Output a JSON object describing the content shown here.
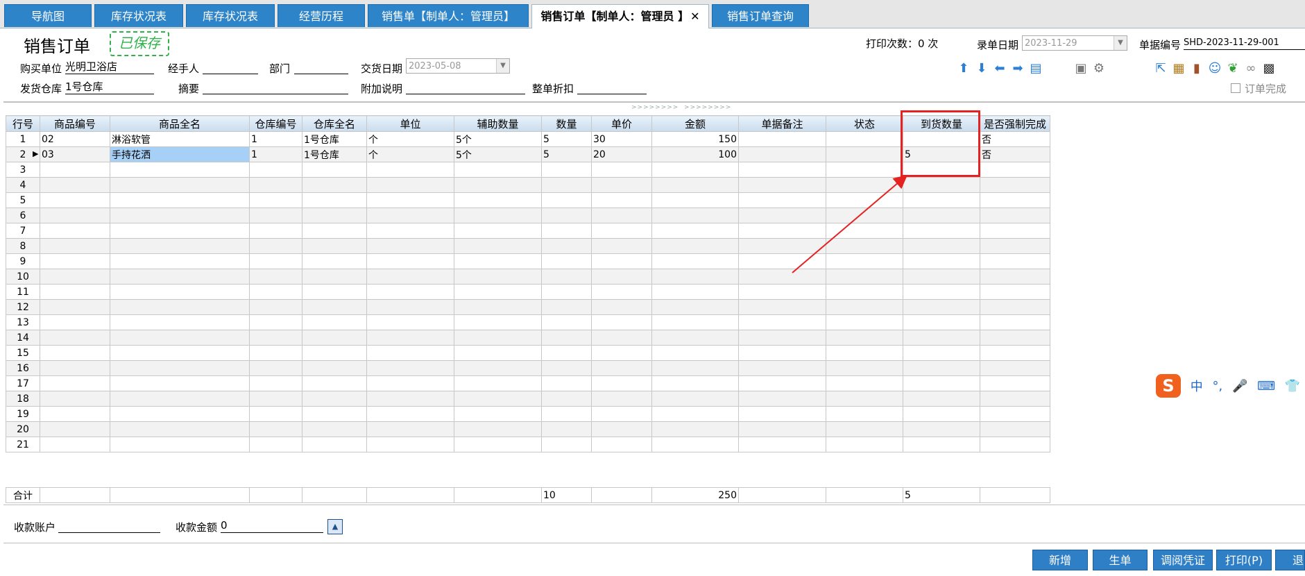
{
  "tabs": [
    {
      "label": "导航图"
    },
    {
      "label": "库存状况表"
    },
    {
      "label": "库存状况表"
    },
    {
      "label": "经营历程"
    },
    {
      "label": "销售单【制单人：管理员】"
    },
    {
      "label": "销售订单【制单人：管理员 】",
      "close": "✕"
    },
    {
      "label": "销售订单查询"
    }
  ],
  "header": {
    "title": "销售订单",
    "stamp": "已保存",
    "print_count_label": "打印次数：0 次",
    "entry_date_label": "录单日期",
    "entry_date_value": "2023-11-29",
    "doc_no_label": "单据编号",
    "doc_no_value": "SHD-2023-11-29-001",
    "buyer_label": "购买单位",
    "buyer_value": "光明卫浴店",
    "handler_label": "经手人",
    "handler_value": "",
    "dept_label": "部门",
    "dept_value": "",
    "delivery_date_label": "交货日期",
    "delivery_date_value": "2023-05-08",
    "warehouse_label": "发货仓库",
    "warehouse_value": "1号仓库",
    "summary_label": "摘要",
    "summary_value": "",
    "note_label": "附加说明",
    "note_value": "",
    "discount_label": "整单折扣",
    "discount_value": "",
    "order_complete_label": "订单完成"
  },
  "toolbar_icons": [
    "arrow-up-icon",
    "arrow-down-icon",
    "arrow-left-icon",
    "arrow-right-icon",
    "copy-doc-icon",
    "printer-icon",
    "gear-icon",
    "export-icon",
    "box-icon",
    "door-icon",
    "user-icon",
    "leaf-icon",
    "link-icon",
    "qrcode-icon"
  ],
  "grid": {
    "columns": [
      "行号",
      "商品编号",
      "商品全名",
      "仓库编号",
      "仓库全名",
      "单位",
      "辅助数量",
      "数量",
      "单价",
      "金额",
      "单据备注",
      "状态",
      "到货数量",
      "是否强制完成"
    ],
    "rows": [
      [
        "1",
        "02",
        "淋浴软管",
        "1",
        "1号仓库",
        "个",
        "5个",
        "5",
        "30",
        "150",
        "",
        "",
        "",
        "否"
      ],
      [
        "2",
        "03",
        "手持花洒",
        "1",
        "1号仓库",
        "个",
        "5个",
        "5",
        "20",
        "100",
        "",
        "",
        "5",
        "否"
      ],
      [
        "3",
        "",
        "",
        "",
        "",
        "",
        "",
        "",
        "",
        "",
        "",
        "",
        "",
        ""
      ],
      [
        "4",
        "",
        "",
        "",
        "",
        "",
        "",
        "",
        "",
        "",
        "",
        "",
        "",
        ""
      ],
      [
        "5",
        "",
        "",
        "",
        "",
        "",
        "",
        "",
        "",
        "",
        "",
        "",
        "",
        ""
      ],
      [
        "6",
        "",
        "",
        "",
        "",
        "",
        "",
        "",
        "",
        "",
        "",
        "",
        "",
        ""
      ],
      [
        "7",
        "",
        "",
        "",
        "",
        "",
        "",
        "",
        "",
        "",
        "",
        "",
        "",
        ""
      ],
      [
        "8",
        "",
        "",
        "",
        "",
        "",
        "",
        "",
        "",
        "",
        "",
        "",
        "",
        ""
      ],
      [
        "9",
        "",
        "",
        "",
        "",
        "",
        "",
        "",
        "",
        "",
        "",
        "",
        "",
        ""
      ],
      [
        "10",
        "",
        "",
        "",
        "",
        "",
        "",
        "",
        "",
        "",
        "",
        "",
        "",
        ""
      ],
      [
        "11",
        "",
        "",
        "",
        "",
        "",
        "",
        "",
        "",
        "",
        "",
        "",
        "",
        ""
      ],
      [
        "12",
        "",
        "",
        "",
        "",
        "",
        "",
        "",
        "",
        "",
        "",
        "",
        "",
        ""
      ],
      [
        "13",
        "",
        "",
        "",
        "",
        "",
        "",
        "",
        "",
        "",
        "",
        "",
        "",
        ""
      ],
      [
        "14",
        "",
        "",
        "",
        "",
        "",
        "",
        "",
        "",
        "",
        "",
        "",
        "",
        ""
      ],
      [
        "15",
        "",
        "",
        "",
        "",
        "",
        "",
        "",
        "",
        "",
        "",
        "",
        "",
        ""
      ],
      [
        "16",
        "",
        "",
        "",
        "",
        "",
        "",
        "",
        "",
        "",
        "",
        "",
        "",
        ""
      ],
      [
        "17",
        "",
        "",
        "",
        "",
        "",
        "",
        "",
        "",
        "",
        "",
        "",
        "",
        ""
      ],
      [
        "18",
        "",
        "",
        "",
        "",
        "",
        "",
        "",
        "",
        "",
        "",
        "",
        "",
        ""
      ],
      [
        "19",
        "",
        "",
        "",
        "",
        "",
        "",
        "",
        "",
        "",
        "",
        "",
        "",
        ""
      ],
      [
        "20",
        "",
        "",
        "",
        "",
        "",
        "",
        "",
        "",
        "",
        "",
        "",
        "",
        ""
      ],
      [
        "21",
        "",
        "",
        "",
        "",
        "",
        "",
        "",
        "",
        "",
        "",
        "",
        "",
        ""
      ]
    ],
    "totals": [
      "合计",
      "",
      "",
      "",
      "",
      "",
      "",
      "10",
      "",
      "250",
      "",
      "",
      "5",
      ""
    ]
  },
  "footer": {
    "account_label": "收款账户",
    "account_value": "",
    "amount_label": "收款金额",
    "amount_value": "0",
    "buttons": [
      "新增",
      "生单",
      "调阅凭证",
      "打印(P)",
      "退出"
    ]
  },
  "ime": {
    "items": [
      "中",
      "°,",
      "🎤",
      "⌨",
      "👕",
      "🎮"
    ]
  }
}
